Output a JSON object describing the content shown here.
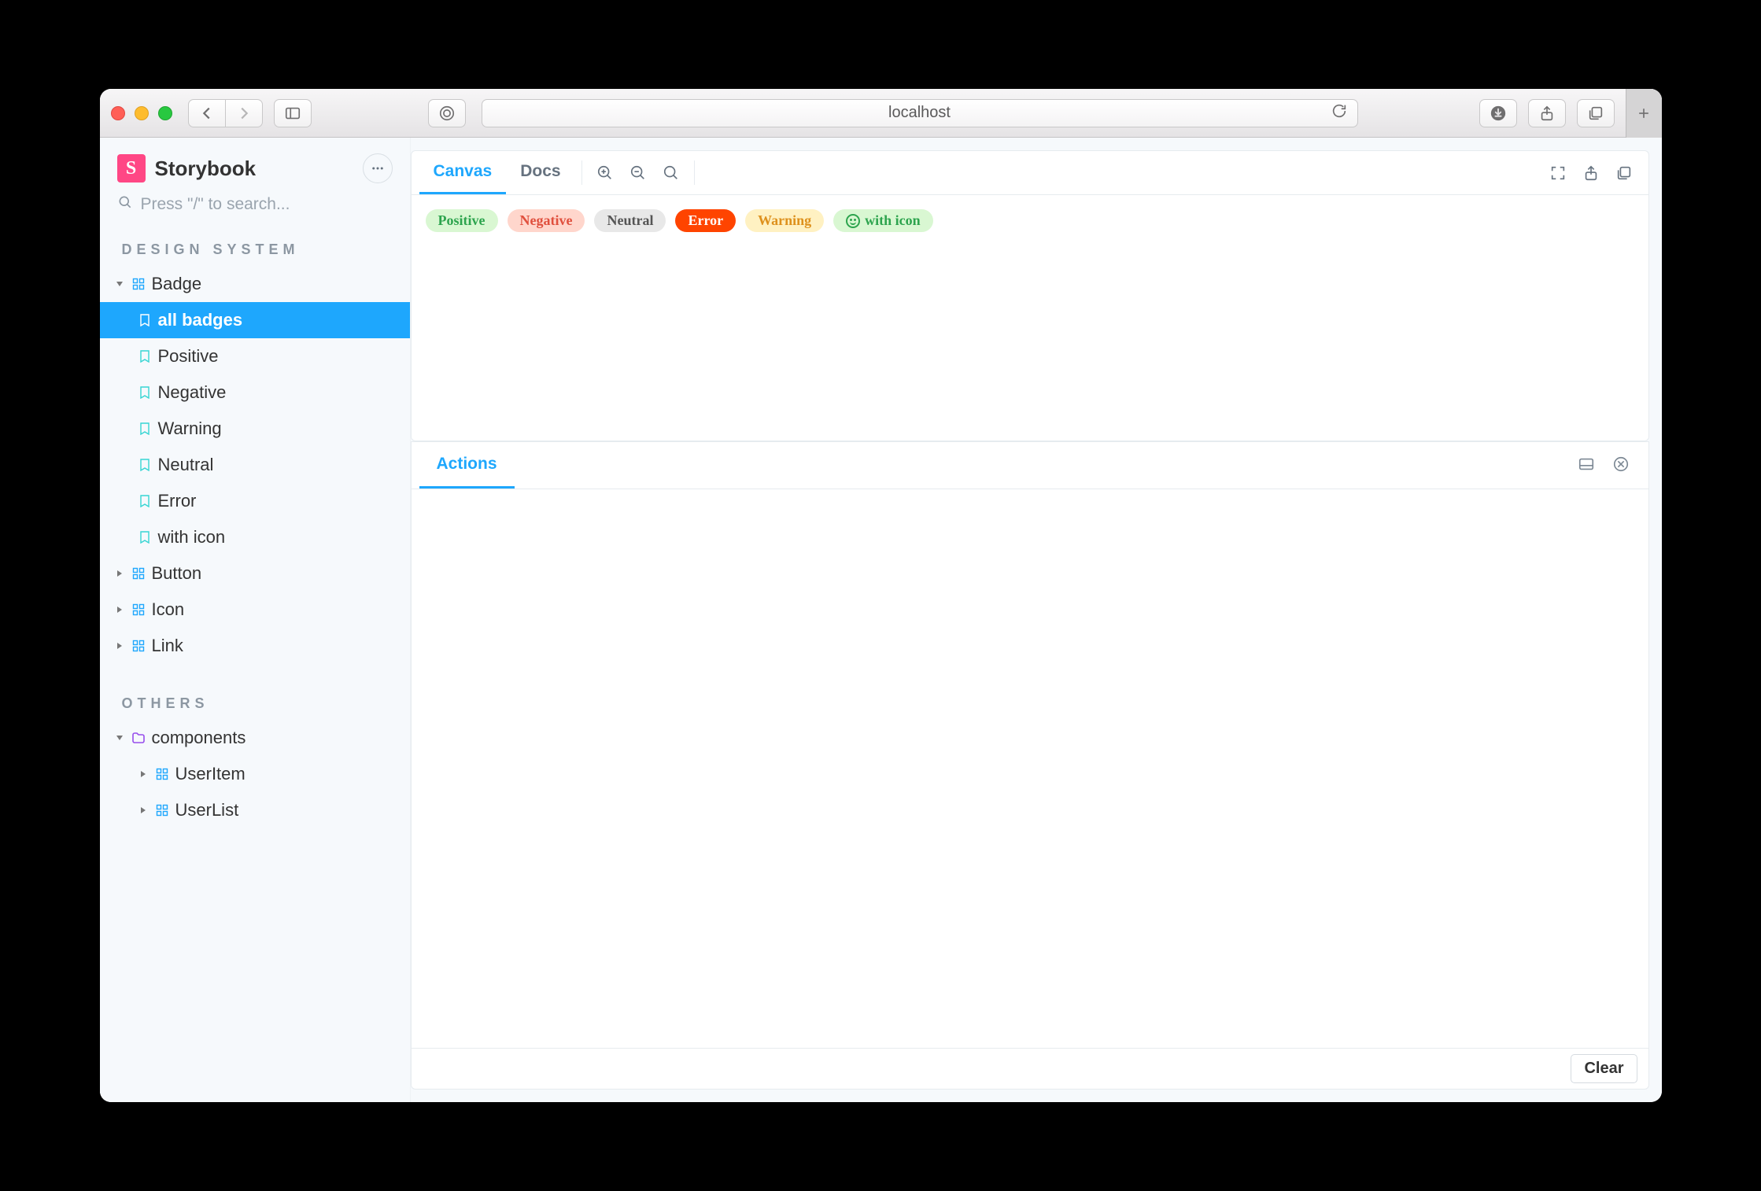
{
  "browser": {
    "url": "localhost"
  },
  "storybook": {
    "brand": "Storybook",
    "search_placeholder": "Press \"/\" to search...",
    "sections": {
      "design_system": {
        "label": "DESIGN SYSTEM",
        "items": {
          "badge": {
            "label": "Badge",
            "stories": {
              "all_badges": "all badges",
              "positive": "Positive",
              "negative": "Negative",
              "warning": "Warning",
              "neutral": "Neutral",
              "error": "Error",
              "with_icon": "with icon"
            }
          },
          "button": {
            "label": "Button"
          },
          "icon": {
            "label": "Icon"
          },
          "link": {
            "label": "Link"
          }
        }
      },
      "others": {
        "label": "OTHERS",
        "items": {
          "components": {
            "label": "components",
            "children": {
              "user_item": "UserItem",
              "user_list": "UserList"
            }
          }
        }
      }
    }
  },
  "tabs": {
    "canvas": "Canvas",
    "docs": "Docs"
  },
  "badges": {
    "positive": "Positive",
    "negative": "Negative",
    "neutral": "Neutral",
    "error": "Error",
    "warning": "Warning",
    "with_icon": "with icon"
  },
  "addons": {
    "actions_tab": "Actions",
    "clear": "Clear"
  }
}
